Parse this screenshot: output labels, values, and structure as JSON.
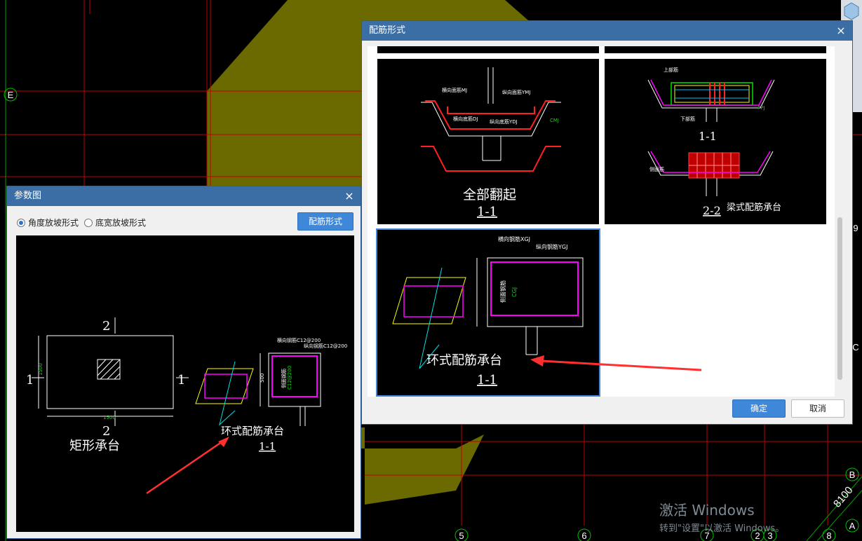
{
  "cad_background": {
    "axis_labels": [
      "E",
      "B",
      "A",
      "5",
      "6",
      "7",
      "2",
      "3",
      "8",
      "9",
      "C"
    ],
    "dimension": "8100"
  },
  "param_dialog": {
    "title": "参数图",
    "close": "×",
    "radio_angle": "角度放坡形式",
    "radio_width": "底宽放坡形式",
    "rebar_button": "配筋形式",
    "figure": {
      "sec_mark_2": "2",
      "sec_mark_1": "1",
      "dim_1500": "1500",
      "dim_500": "500",
      "rect_label": "矩形承台",
      "ring_title": "环式配筋承台",
      "ring_section": "1-1",
      "hor_rebar": "横向钢筋C12@200",
      "ver_rebar": "纵向钢筋C12@200",
      "side_rebar": "侧面钢筋",
      "side_spec": "C12@200"
    }
  },
  "rebar_dialog": {
    "title": "配筋形式",
    "close": "×",
    "confirm": "确定",
    "cancel": "取消",
    "card1": {
      "label": "全部翻起",
      "section": "1-1",
      "t_mj": "横向面筋MJ",
      "t_ymj": "纵向面筋YMJ",
      "t_dj": "横向底筋DJ",
      "t_ydj": "纵向底筋YDJ",
      "t_cmj": "CMJ"
    },
    "card2": {
      "sec_a": "1-1",
      "sec_b": "2-2",
      "label": "梁式配筋承台",
      "t_top": "上部筋",
      "t_bot": "下部筋",
      "t_side": "侧面筋",
      "t_pp": "PPJ"
    },
    "card3": {
      "label": "环式配筋承台",
      "section": "1-1",
      "t_xgj": "横向钢筋XGJ",
      "t_ygj": "纵向钢筋YGJ",
      "t_side": "侧面钢筋",
      "t_cgj": "CGJ"
    }
  },
  "watermark": {
    "line1": "激活 Windows",
    "line2": "转到\"设置\"以激活 Windows。"
  }
}
